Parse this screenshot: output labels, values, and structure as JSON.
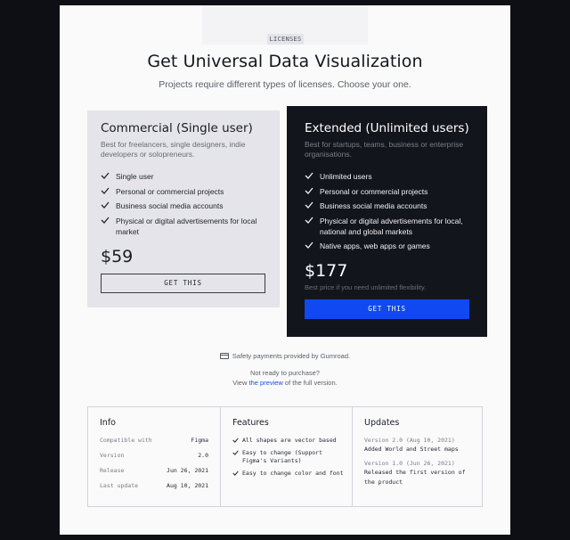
{
  "badge": "LICENSES",
  "title": "Get Universal Data Visualization",
  "subtitle": "Projects require different types of licenses. Choose your one.",
  "commercial": {
    "title": "Commercial (Single user)",
    "description": "Best for freelancers, single designers, indie developers or solopreneurs.",
    "features": [
      "Single user",
      "Personal or commercial projects",
      "Business social media accounts",
      "Physical or digital advertisements for local market"
    ],
    "price": "$59",
    "button": "GET THIS"
  },
  "extended": {
    "title": "Extended (Unlimited users)",
    "description": "Best for startups, teams, business or enterprise organisations.",
    "features": [
      "Unlimited users",
      "Personal or commercial projects",
      "Business social media accounts",
      "Physical or digital advertisements for local, national and global markets",
      "Native apps, web apps or games"
    ],
    "price": "$177",
    "price_note": "Best price if you need unlimited flexibility.",
    "button": "GET THIS",
    "accent_color": "#1049f0"
  },
  "safety": "Safety payments provided by Gumroad.",
  "not_ready": {
    "line1": "Not ready to purchase?",
    "prefix": "View ",
    "link": "the preview",
    "suffix": " of the full version."
  },
  "info": {
    "title": "Info",
    "rows": [
      {
        "key": "Compatible with",
        "value": "Figma"
      },
      {
        "key": "Version",
        "value": "2.0"
      },
      {
        "key": "Release",
        "value": "Jun 26, 2021"
      },
      {
        "key": "Last update",
        "value": "Aug 10, 2021"
      }
    ]
  },
  "features": {
    "title": "Features",
    "items": [
      "All shapes are vector based",
      "Easy to change (Support Figma's Variants)",
      "Easy to change color and font"
    ]
  },
  "updates": {
    "title": "Updates",
    "items": [
      {
        "version": "Version 2.0 (Aug 10, 2021)",
        "text": "Added World and Street maps"
      },
      {
        "version": "Version 1.0 (Jun 26, 2021)",
        "text": "Released the first version of the product"
      }
    ]
  }
}
